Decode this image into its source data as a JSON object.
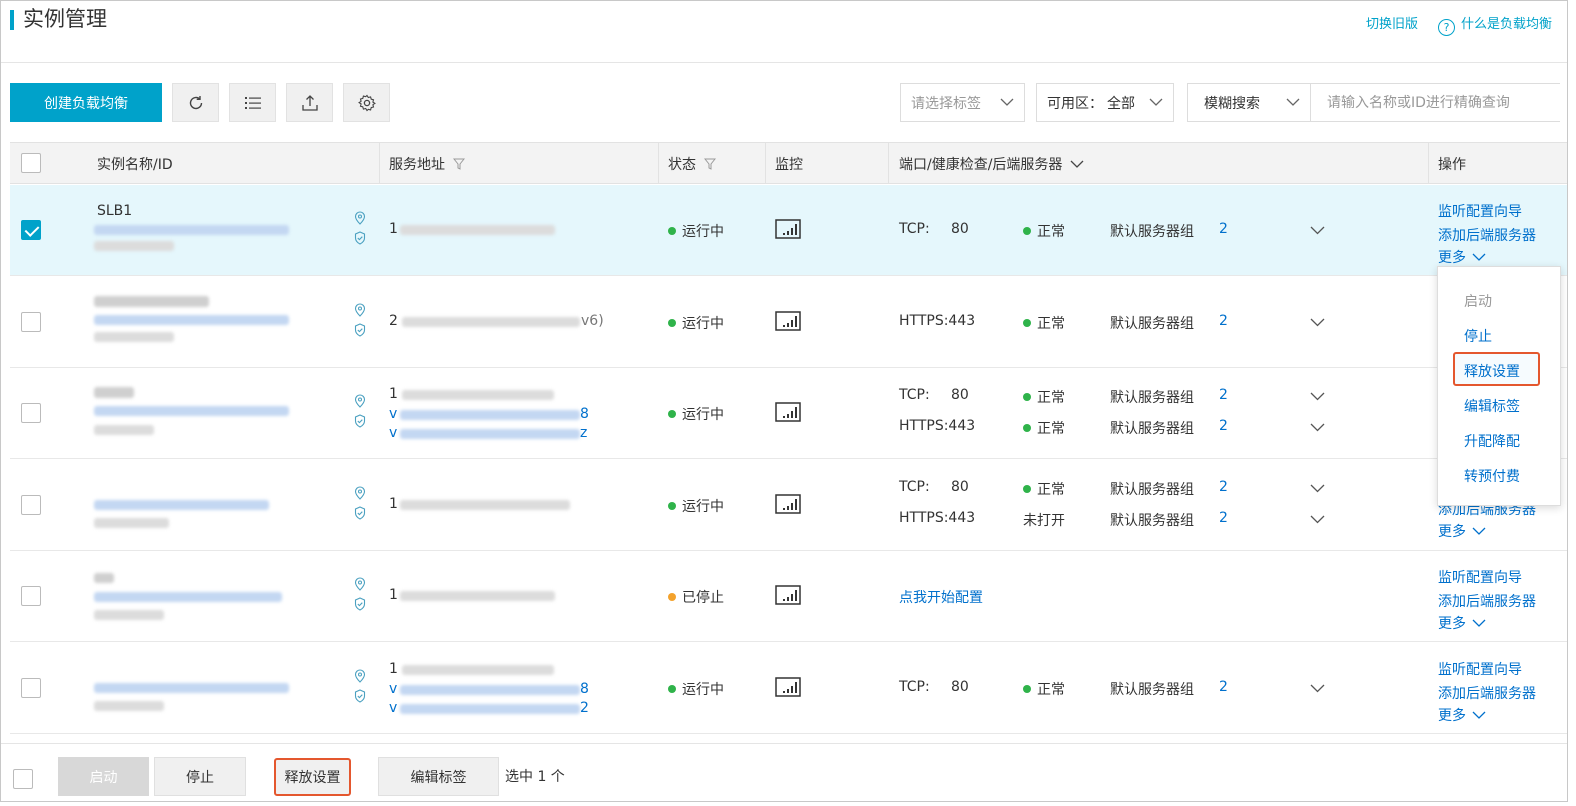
{
  "header": {
    "title": "实例管理",
    "switch_old": "切换旧版",
    "help_icon": "?",
    "help_text": "什么是负载均衡"
  },
  "toolbar": {
    "create_label": "创建负载均衡",
    "icons": [
      "refresh-icon",
      "list-icon",
      "export-icon",
      "settings-icon"
    ],
    "tag_select_placeholder": "请选择标签",
    "zone_label": "可用区：",
    "zone_value": "全部",
    "search_mode": "模糊搜索",
    "search_placeholder": "请输入名称或ID进行精确查询"
  },
  "table": {
    "columns": {
      "name": "实例名称/ID",
      "address": "服务地址",
      "status": "状态",
      "monitor": "监控",
      "ports": "端口/健康检查/后端服务器",
      "actions": "操作"
    },
    "rows": [
      {
        "name": "SLB1",
        "address_prefix": "1",
        "status": "运行中",
        "checked": true,
        "listeners": [
          {
            "protocol": "TCP:",
            "port": "80",
            "health": "正常",
            "backend": "默认服务器组",
            "count": "2"
          }
        ],
        "actions": [
          "监听配置向导",
          "添加后端服务器",
          "更多"
        ]
      },
      {
        "name": "",
        "address_prefix": "2",
        "address_suffix": "v6)",
        "status": "运行中",
        "checked": false,
        "listeners": [
          {
            "protocol": "HTTPS:443",
            "port": "",
            "health": "正常",
            "backend": "默认服务器组",
            "count": "2"
          }
        ]
      },
      {
        "name": "",
        "address_prefix": "1",
        "address_link_1": "v",
        "address_link_1_tail": "8",
        "address_link_2": "v",
        "address_link_2_tail": "z",
        "status": "运行中",
        "checked": false,
        "listeners": [
          {
            "protocol": "TCP:",
            "port": "80",
            "health": "正常",
            "backend": "默认服务器组",
            "count": "2"
          },
          {
            "protocol": "HTTPS:443",
            "port": "",
            "health": "正常",
            "backend": "默认服务器组",
            "count": "2"
          }
        ]
      },
      {
        "name": "",
        "address_prefix": "1",
        "status": "运行中",
        "checked": false,
        "listeners": [
          {
            "protocol": "TCP:",
            "port": "80",
            "health": "正常",
            "backend": "默认服务器组",
            "count": "2"
          },
          {
            "protocol": "HTTPS:443",
            "port": "",
            "health": "未打开",
            "backend": "默认服务器组",
            "count": "2"
          }
        ],
        "actions": [
          "添加后端服务器",
          "更多"
        ]
      },
      {
        "name": "",
        "address_prefix": "1",
        "status": "已停止",
        "checked": false,
        "config_link": "点我开始配置",
        "actions": [
          "监听配置向导",
          "添加后端服务器",
          "更多"
        ]
      },
      {
        "name": "",
        "address_prefix": "1",
        "address_link_1": "v",
        "address_link_1_tail": "8",
        "address_link_2": "v",
        "address_link_2_tail": "2",
        "status": "运行中",
        "checked": false,
        "listeners": [
          {
            "protocol": "TCP:",
            "port": "80",
            "health": "正常",
            "backend": "默认服务器组",
            "count": "2"
          }
        ],
        "actions": [
          "监听配置向导",
          "添加后端服务器",
          "更多"
        ]
      }
    ]
  },
  "more_menu": {
    "items": [
      "启动",
      "停止",
      "释放设置",
      "编辑标签",
      "升配降配",
      "转预付费"
    ],
    "disabled_item": "启动",
    "highlighted_item": "释放设置"
  },
  "footer": {
    "start": "启动",
    "stop": "停止",
    "release": "释放设置",
    "edit_tags": "编辑标签",
    "selected_text": "选中 1 个"
  },
  "colors": {
    "accent": "#00a2ca",
    "link": "#0070cc",
    "running": "#2fb34a",
    "stopped": "#f3a22c",
    "highlight_border": "#e4572e"
  }
}
